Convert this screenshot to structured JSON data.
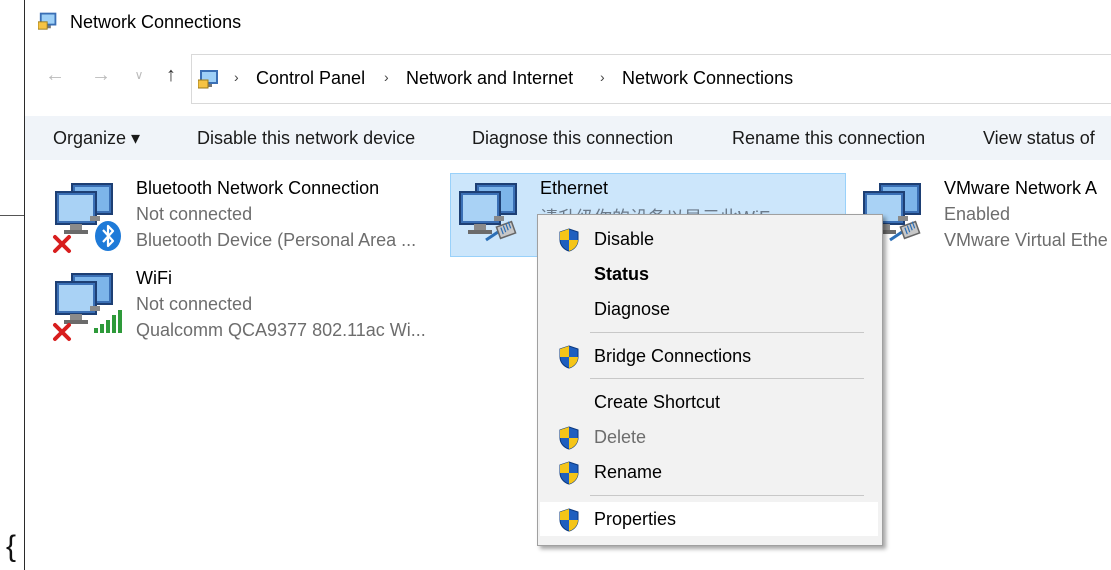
{
  "window": {
    "title": "Network Connections"
  },
  "address": {
    "crumbs": [
      "Control Panel",
      "Network and Internet",
      "Network Connections"
    ]
  },
  "toolbar": {
    "organize": "Organize ▾",
    "disable": "Disable this network device",
    "diagnose": "Diagnose this connection",
    "rename": "Rename this connection",
    "view_status": "View status of"
  },
  "connections": [
    {
      "name": "Bluetooth Network Connection",
      "status": "Not connected",
      "device": "Bluetooth Device (Personal Area ..."
    },
    {
      "name": "WiFi",
      "status": "Not connected",
      "device": "Qualcomm QCA9377 802.11ac Wi..."
    },
    {
      "name": "Ethernet",
      "status": "请升级你的设备以显示此WiF",
      "device": ""
    },
    {
      "name": "VMware Network A",
      "status": "Enabled",
      "device": "VMware Virtual Ethe"
    }
  ],
  "context_menu": {
    "items": [
      {
        "label": "Disable",
        "shield": true
      },
      {
        "label": "Status",
        "bold": true
      },
      {
        "label": "Diagnose"
      },
      {
        "label": "Bridge Connections",
        "shield": true
      },
      {
        "label": "Create Shortcut"
      },
      {
        "label": "Delete",
        "shield": true,
        "disabled": true
      },
      {
        "label": "Rename",
        "shield": true
      },
      {
        "label": "Properties",
        "shield": true,
        "hovered": true
      }
    ]
  },
  "colors": {
    "selection_bg": "#cce6fb",
    "toolbar_bg": "#f0f4f9",
    "menu_bg": "#f2f2f2",
    "shield_blue": "#1f5fbf",
    "shield_yellow": "#f5c518",
    "error_red": "#d81e1e"
  }
}
